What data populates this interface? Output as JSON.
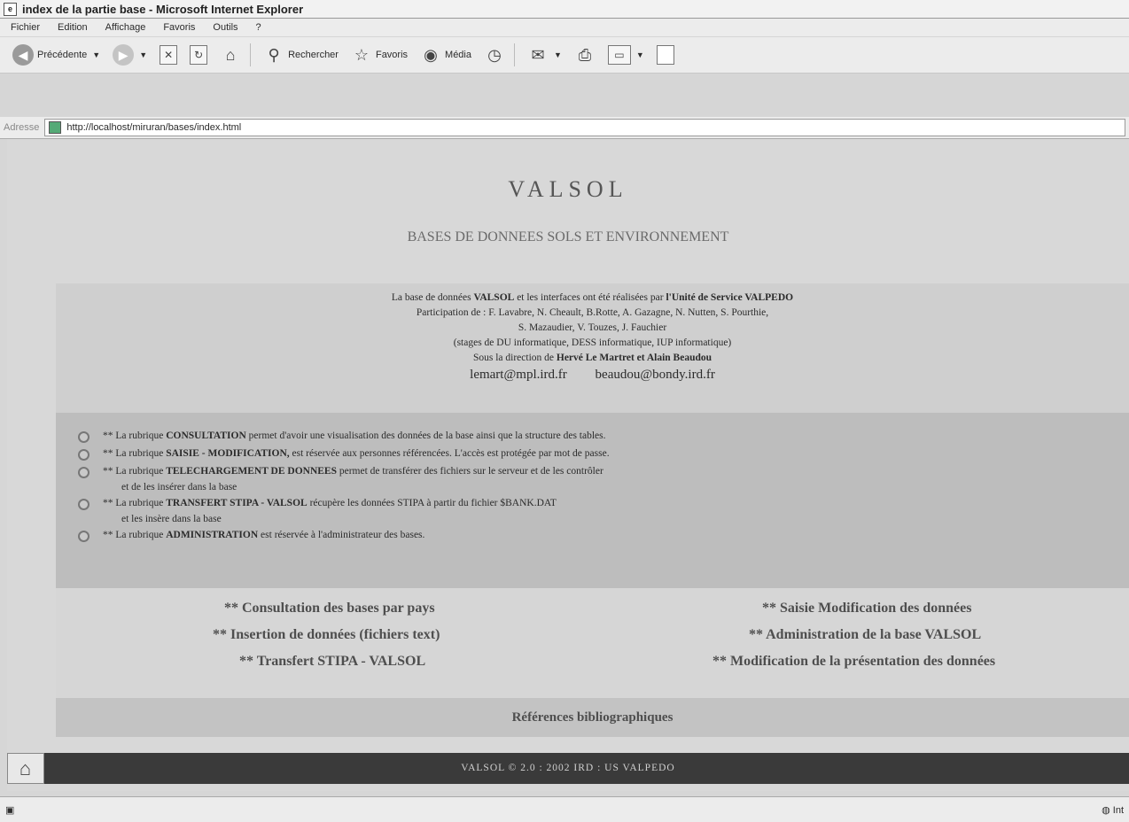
{
  "window": {
    "title": "index de la partie base - Microsoft Internet Explorer"
  },
  "menu": [
    "Fichier",
    "Edition",
    "Affichage",
    "Favoris",
    "Outils",
    "?"
  ],
  "toolbar": {
    "back_label": "Précédente",
    "search_label": "Rechercher",
    "favorites_label": "Favoris",
    "media_label": "Média"
  },
  "address": {
    "label": "Adresse",
    "url": "http://localhost/miruran/bases/index.html"
  },
  "header": {
    "title": "VALSOL",
    "subtitle": "BASES DE DONNEES SOLS ET ENVIRONNEMENT"
  },
  "credits": {
    "line1_pre": "La base de données ",
    "line1_bold1": "VALSOL",
    "line1_mid": " et les interfaces ont été réalisées par ",
    "line1_bold2": "l'Unité de Service VALPEDO",
    "line2": "Participation de : F. Lavabre, N. Cheault, B.Rotte, A. Gazagne, N. Nutten, S. Pourthie,",
    "line3": "S. Mazaudier, V. Touzes, J. Fauchier",
    "line4": "(stages de DU informatique, DESS informatique, IUP informatique)",
    "line5_pre": "Sous la direction de ",
    "line5_bold": "Hervé Le Martret et Alain Beaudou",
    "email1": "lemart@mpl.ird.fr",
    "email2": "beaudou@bondy.ird.fr"
  },
  "sections": [
    {
      "pre": "** La rubrique ",
      "bold": "CONSULTATION",
      "post": " permet d'avoir une visualisation des données de la base ainsi que la structure des tables.",
      "cont": ""
    },
    {
      "pre": "** La rubrique ",
      "bold": "SAISIE - MODIFICATION,",
      "post": " est réservée aux personnes référencées. L'accès est protégée par mot de passe.",
      "cont": ""
    },
    {
      "pre": "** La rubrique ",
      "bold": "TELECHARGEMENT DE DONNEES",
      "post": " permet de transférer des fichiers sur le serveur et de les contrôler",
      "cont": "et de les insérer dans la base"
    },
    {
      "pre": "** La rubrique ",
      "bold": "TRANSFERT STIPA - VALSOL",
      "post": " récupère les données STIPA à partir du fichier $BANK.DAT",
      "cont": "et les insère dans la base"
    },
    {
      "pre": "** La rubrique ",
      "bold": "ADMINISTRATION",
      "post": " est réservée à l'administrateur des bases.",
      "cont": ""
    }
  ],
  "links": {
    "left": [
      "** Consultation des bases par pays",
      "** Insertion de données (fichiers text)",
      "** Transfert STIPA - VALSOL"
    ],
    "right": [
      "** Saisie Modification des données",
      "** Administration de la base VALSOL",
      "** Modification de la présentation des données"
    ]
  },
  "biblio": "Références bibliographiques",
  "footer": "VALSOL © 2.0 : 2002 IRD : US VALPEDO",
  "status": {
    "right": "Int"
  },
  "icons": {
    "home": "home-icon",
    "back": "back-arrow-icon",
    "forward": "forward-arrow-icon",
    "search": "search-icon",
    "favorites": "star-icon",
    "media": "media-icon"
  }
}
